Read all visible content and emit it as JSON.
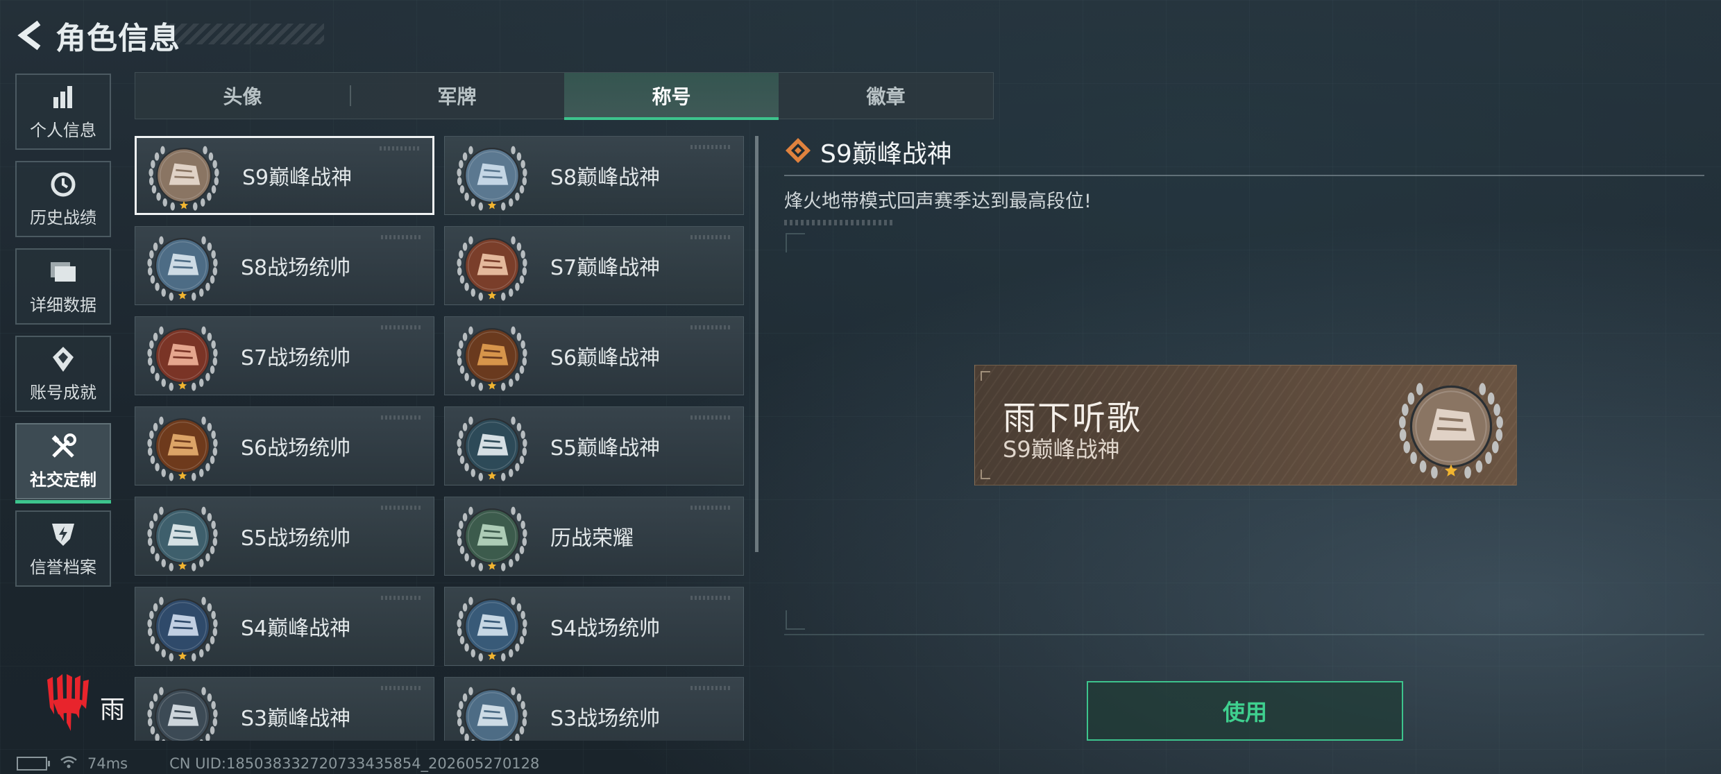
{
  "header": {
    "title": "角色信息"
  },
  "sidebar": {
    "items": [
      {
        "label": "个人信息",
        "icon": "bar-chart-icon",
        "active": false
      },
      {
        "label": "历史战绩",
        "icon": "clock-history-icon",
        "active": false
      },
      {
        "label": "详细数据",
        "icon": "folder-stack-icon",
        "active": false
      },
      {
        "label": "账号成就",
        "icon": "achievement-diamond-icon",
        "active": false
      },
      {
        "label": "社交定制",
        "icon": "wrench-screwdriver-icon",
        "active": true
      },
      {
        "label": "信誉档案",
        "icon": "shield-bolt-icon",
        "active": false
      }
    ]
  },
  "tabs": [
    {
      "label": "头像",
      "active": false
    },
    {
      "label": "军牌",
      "active": false
    },
    {
      "label": "称号",
      "active": true
    },
    {
      "label": "徽章",
      "active": false
    }
  ],
  "titles": [
    {
      "label": "S9巅峰战神",
      "medal": "fortress-medal",
      "selected": true
    },
    {
      "label": "S8巅峰战神",
      "medal": "blue-emblem-medal",
      "selected": false
    },
    {
      "label": "S8战场统帅",
      "medal": "tank-medal",
      "selected": false
    },
    {
      "label": "S7巅峰战神",
      "medal": "crossbow-medal",
      "selected": false
    },
    {
      "label": "S7战场统帅",
      "medal": "armored-car-medal",
      "selected": false
    },
    {
      "label": "S6巅峰战神",
      "medal": "shield-t-medal",
      "selected": false
    },
    {
      "label": "S6战场统帅",
      "medal": "jet-medal",
      "selected": false
    },
    {
      "label": "S5巅峰战神",
      "medal": "diver-mask-medal",
      "selected": false
    },
    {
      "label": "S5战场统帅",
      "medal": "boat-medal",
      "selected": false
    },
    {
      "label": "历战荣耀",
      "medal": "trophy-medal",
      "selected": false
    },
    {
      "label": "S4巅峰战神",
      "medal": "helmet-medal",
      "selected": false
    },
    {
      "label": "S4战场统帅",
      "medal": "missile-medal",
      "selected": false
    },
    {
      "label": "S3巅峰战神",
      "medal": "globe-medal",
      "selected": false
    },
    {
      "label": "S3战场统帅",
      "medal": "tank-medal",
      "selected": false
    }
  ],
  "detail": {
    "title": "S9巅峰战神",
    "description": "烽火地带模式回声赛季达到最高段位!",
    "icon": "diamond-rank-icon"
  },
  "preview": {
    "player_name": "雨下听歌",
    "title": "S9巅峰战神"
  },
  "actions": {
    "use_label": "使用"
  },
  "footer": {
    "logo_char": "雨",
    "ping": "74ms",
    "uid": "CN UID:185038332720733435854_202605270128"
  },
  "colors": {
    "accent": "#3dc48d",
    "card_bg": "#3a464e",
    "preview_bg": "#5c4a3c"
  }
}
